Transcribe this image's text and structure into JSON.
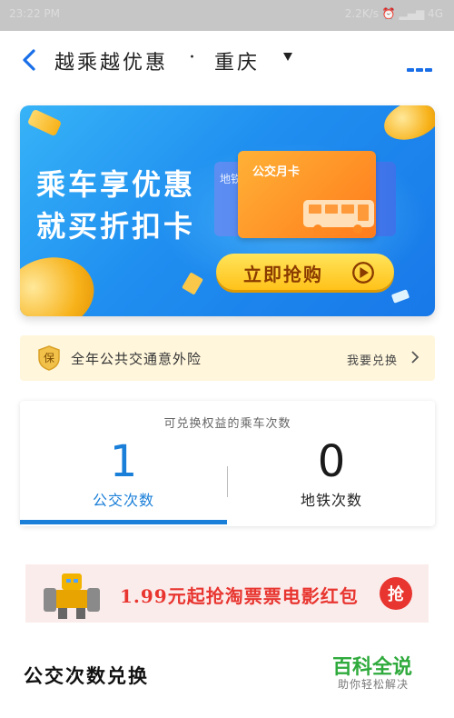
{
  "status_bar": {
    "time": "23:22 PM",
    "right": "2.2K/s ⏰ ▂▄▆ 4G"
  },
  "nav": {
    "title": "越乘越优惠",
    "separator": "·",
    "city": "重庆",
    "back_icon": "chevron-left-icon",
    "more_icon": "more-dots-icon",
    "accent": "#1a6fe8"
  },
  "banner": {
    "line1": "乘车享优惠",
    "line2": "就买折扣卡",
    "card_back_label": "地铁",
    "card_front_label": "公交月卡",
    "cta_label": "立即抢购",
    "colors": {
      "bg_start": "#37b3f7",
      "bg_end": "#1878e8",
      "cta": "#ffc21a"
    }
  },
  "insurance": {
    "badge": "保",
    "text": "全年公共交通意外险",
    "link": "我要兑换"
  },
  "counts": {
    "caption": "可兑换权益的乘车次数",
    "bus": {
      "value": "1",
      "label": "公交次数"
    },
    "metro": {
      "value": "0",
      "label": "地铁次数"
    },
    "active_color": "#1a7fd8"
  },
  "promo": {
    "text": "1.99元起抢淘票票电影红包",
    "button": "抢",
    "color": "#e8352f"
  },
  "section": {
    "title": "公交次数兑换"
  },
  "watermark": {
    "main": "百科全说",
    "sub": "助你轻松解决"
  }
}
